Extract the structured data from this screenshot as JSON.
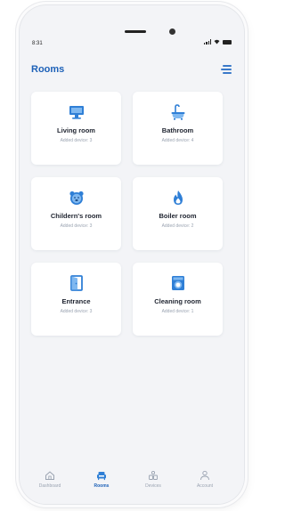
{
  "status": {
    "time": "8:31"
  },
  "header": {
    "title": "Rooms",
    "menu_icon": "menu-icon"
  },
  "accent_color": "#1d61b8",
  "rooms": [
    {
      "name": "Living room",
      "sub": "Added device: 3",
      "icon": "monitor-icon"
    },
    {
      "name": "Bathroom",
      "sub": "Added device: 4",
      "icon": "bathtub-icon"
    },
    {
      "name": "Childern's room",
      "sub": "Added device: 3",
      "icon": "teddy-bear-icon"
    },
    {
      "name": "Boiler room",
      "sub": "Added device: 2",
      "icon": "flame-icon"
    },
    {
      "name": "Entrance",
      "sub": "Added device: 3",
      "icon": "door-icon"
    },
    {
      "name": "Cleaning room",
      "sub": "Added device: 1",
      "icon": "washing-machine-icon"
    }
  ],
  "tabs": [
    {
      "label": "Dashboard",
      "icon": "home-icon",
      "active": false
    },
    {
      "label": "Rooms",
      "icon": "sofa-icon",
      "active": true
    },
    {
      "label": "Devices",
      "icon": "devices-icon",
      "active": false
    },
    {
      "label": "Account",
      "icon": "user-icon",
      "active": false
    }
  ]
}
